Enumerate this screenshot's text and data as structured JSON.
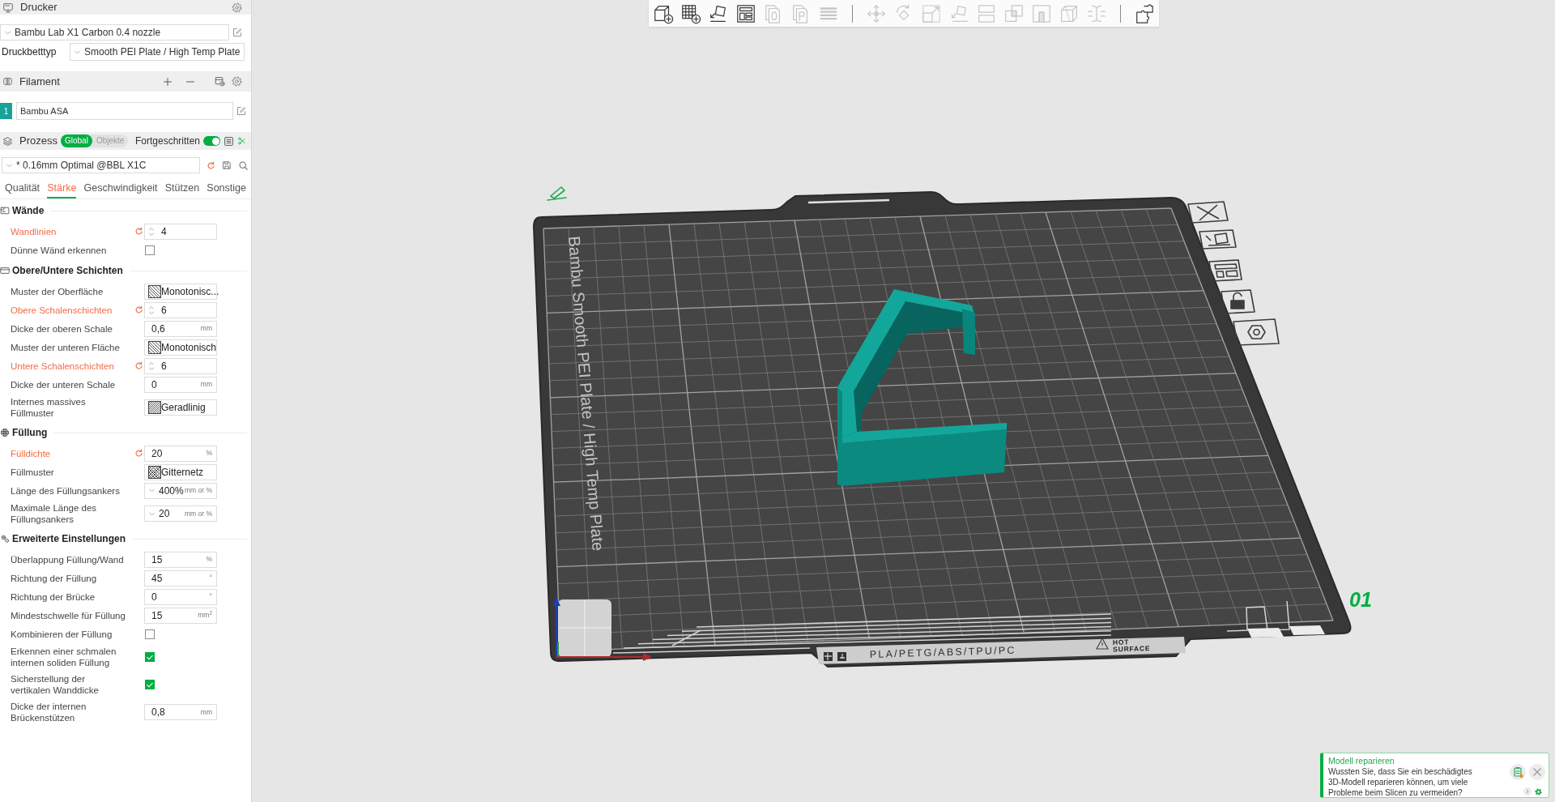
{
  "printer": {
    "title": "Drucker",
    "preset": "Bambu Lab X1 Carbon 0.4 nozzle",
    "bed_label": "Druckbetttyp",
    "bed_type": "Smooth PEI Plate / High Temp Plate"
  },
  "filament": {
    "title": "Filament",
    "slots": [
      {
        "number": "1",
        "name": "Bambu ASA",
        "color": "#17a398"
      }
    ]
  },
  "process": {
    "title": "Prozess",
    "scope": [
      {
        "label": "Global",
        "selected": true
      },
      {
        "label": "Objekte",
        "selected": false
      }
    ],
    "advanced_label": "Fortgeschritten",
    "advanced": true,
    "preset": "* 0.16mm Optimal @BBL X1C",
    "tabs": [
      {
        "label": "Qualität",
        "selected": false
      },
      {
        "label": "Stärke",
        "selected": true
      },
      {
        "label": "Geschwindigkeit",
        "selected": false
      },
      {
        "label": "Stützen",
        "selected": false
      },
      {
        "label": "Sonstige",
        "selected": false
      }
    ],
    "sections": [
      {
        "title": "Wände",
        "rows": [
          {
            "kind": "spin",
            "label": "Wandlinien",
            "modified": true,
            "value": "4"
          },
          {
            "kind": "checkbox",
            "label": "Dünne Wänd erkennen",
            "modified": false,
            "checked": false
          }
        ]
      },
      {
        "title": "Obere/Untere Schichten",
        "rows": [
          {
            "kind": "pattern",
            "label": "Muster der Oberfläche",
            "modified": false,
            "value": "Monotonisc..."
          },
          {
            "kind": "spin",
            "label": "Obere Schalenschichten",
            "modified": true,
            "value": "6"
          },
          {
            "kind": "number",
            "label": "Dicke der oberen Schale",
            "modified": false,
            "value": "0,6",
            "unit": "mm"
          },
          {
            "kind": "pattern",
            "label": "Muster der unteren Fläche",
            "modified": false,
            "value": "Monotonisch"
          },
          {
            "kind": "spin",
            "label": "Untere Schalenschichten",
            "modified": true,
            "value": "6"
          },
          {
            "kind": "number",
            "label": "Dicke der unteren Schale",
            "modified": false,
            "value": "0",
            "unit": "mm"
          },
          {
            "kind": "pattern",
            "label": "Internes massives\nFüllmuster",
            "modified": false,
            "value": "Geradlinig"
          }
        ]
      },
      {
        "title": "Füllung",
        "rows": [
          {
            "kind": "number",
            "label": "Fülldichte",
            "modified": true,
            "value": "20",
            "unit": "%"
          },
          {
            "kind": "pattern",
            "label": "Füllmuster",
            "modified": false,
            "value": "Gitternetz"
          },
          {
            "kind": "combo",
            "label": "Länge des Füllungsankers",
            "modified": false,
            "value": "400%",
            "unit": "mm or %"
          },
          {
            "kind": "combo",
            "label": "Maximale Länge des\nFüllungsankers",
            "modified": false,
            "value": "20",
            "unit": "mm or %"
          }
        ]
      },
      {
        "title": "Erweiterte Einstellungen",
        "rows": [
          {
            "kind": "number",
            "label": "Überlappung Füllung/Wand",
            "modified": false,
            "value": "15",
            "unit": "%"
          },
          {
            "kind": "number",
            "label": "Richtung der Füllung",
            "modified": false,
            "value": "45",
            "unit": "°"
          },
          {
            "kind": "number",
            "label": "Richtung der Brücke",
            "modified": false,
            "value": "0",
            "unit": "°"
          },
          {
            "kind": "number",
            "label": "Mindestschwelle für Füllung",
            "modified": false,
            "value": "15",
            "unit": "mm$^{2}$"
          },
          {
            "kind": "checkbox",
            "label": "Kombinieren der Füllung",
            "modified": false,
            "checked": false
          },
          {
            "kind": "checkbox",
            "label": "Erkennen einer schmalen\ninternen soliden Füllung",
            "modified": false,
            "checked": true
          },
          {
            "kind": "checkbox",
            "label": "Sicherstellung der\nvertikalen Wanddicke",
            "modified": false,
            "checked": true
          },
          {
            "kind": "number",
            "label": "Dicke der internen\nBrückenstützen",
            "modified": false,
            "value": "0,8",
            "unit": "mm"
          }
        ]
      }
    ]
  },
  "toolbar": [
    [
      {
        "disabled": false
      },
      {
        "disabled": false
      },
      {
        "disabled": false
      },
      {
        "disabled": false
      },
      {
        "disabled": true
      },
      {
        "disabled": true
      },
      {
        "disabled": true
      }
    ],
    [
      {
        "disabled": true
      },
      {
        "disabled": true
      },
      {
        "disabled": true
      },
      {
        "disabled": true
      },
      {
        "disabled": true
      },
      {
        "disabled": true
      },
      {
        "disabled": true
      },
      {
        "disabled": true
      },
      {
        "disabled": true
      }
    ],
    [
      {
        "disabled": false
      }
    ]
  ],
  "viewport": {
    "plate_label": "Bambu Smooth PEI Plate / High Temp Plate",
    "material_label": "PLA/PETG/ABS/TPU/PC",
    "warning_lines": [
      "HOT",
      "SURFACE"
    ],
    "plate_number": "01"
  },
  "notification": {
    "title": "Modell reparieren",
    "text": "Wussten Sie, dass Sie ein beschädigtes\n3D-Modell reparieren können, um viele\nProbleme beim Slicen zu vermeiden?"
  }
}
